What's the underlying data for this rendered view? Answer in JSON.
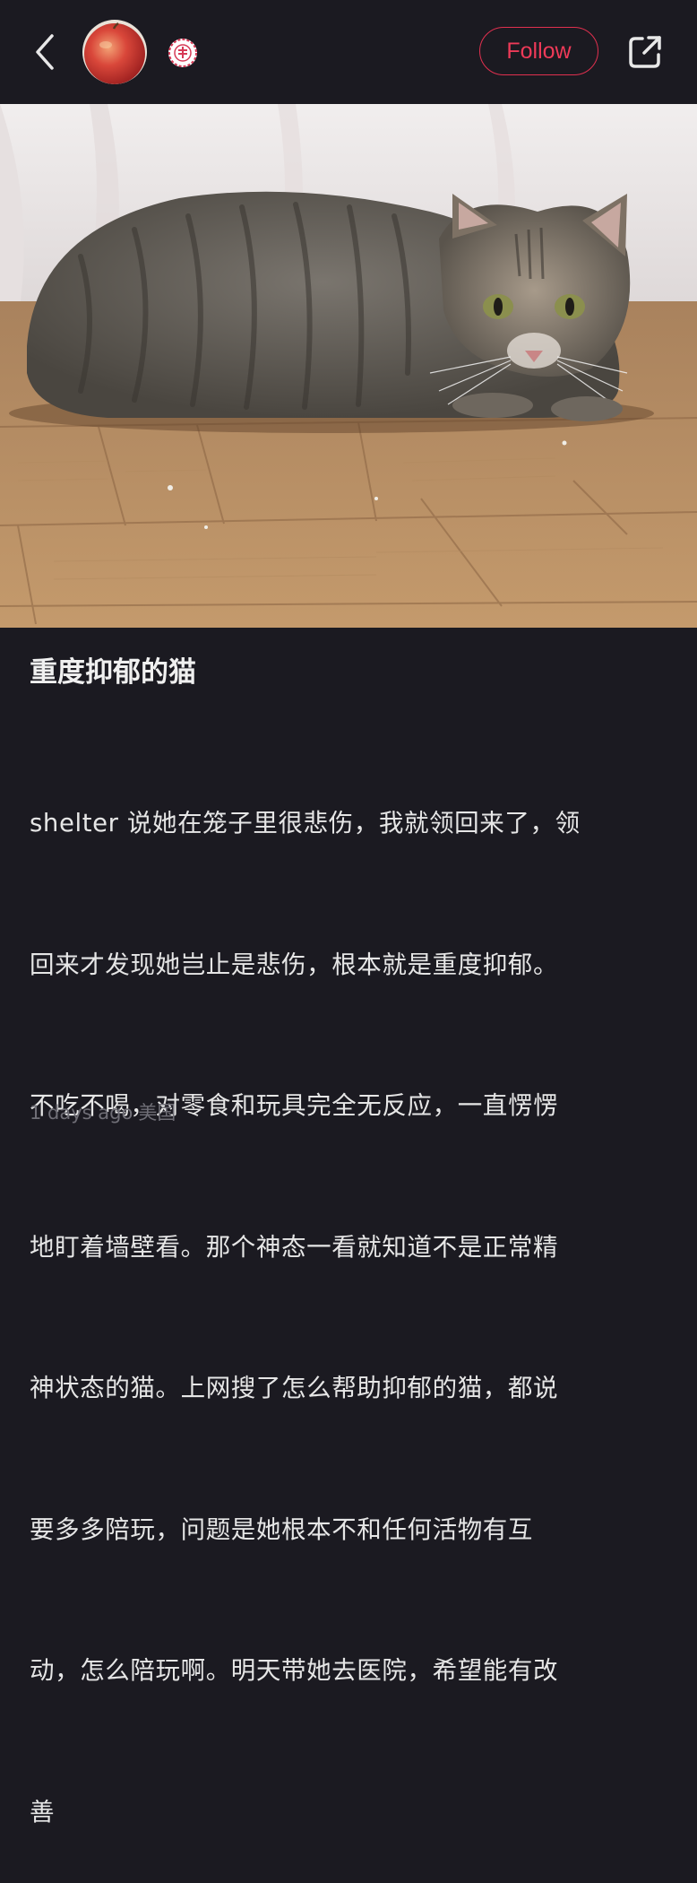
{
  "header": {
    "back_icon": "chevron-left-icon",
    "avatar_icon": "red-apple-avatar",
    "badge_icon": "pink-seal-badge",
    "follow_label": "Follow",
    "share_icon": "share-external-icon"
  },
  "colors": {
    "background": "#1b1a21",
    "accent": "#e0304f",
    "meta": "#6f6e76"
  },
  "post": {
    "title": "重度抑郁的猫",
    "lines": [
      "shelter 说她在笼子里很悲伤，我就领回来了，领",
      "回来才发现她岂止是悲伤，根本就是重度抑郁。",
      "不吃不喝，对零食和玩具完全无反应，一直愣愣",
      "地盯着墙壁看。那个神态一看就知道不是正常精",
      "神状态的猫。上网搜了怎么帮助抑郁的猫，都说",
      "要多多陪玩，问题是她根本不和任何活物有互",
      "动，怎么陪玩啊。明天带她去医院，希望能有改",
      "善"
    ],
    "time": "1 days ago",
    "location": "美国"
  }
}
